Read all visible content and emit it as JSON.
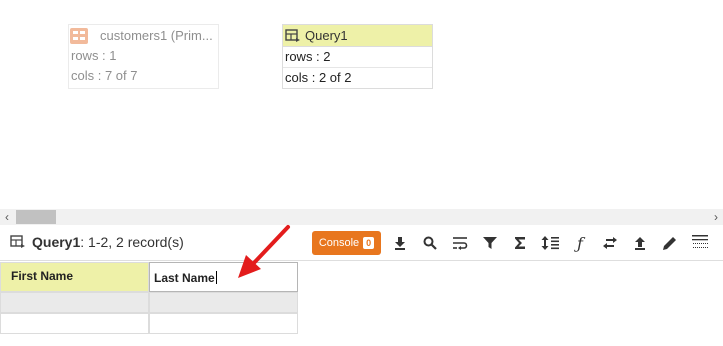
{
  "canvas": {
    "tables": [
      {
        "title": "customers1 (Prim...",
        "rows_text": "rows : 1",
        "cols_text": "cols : 7 of 7"
      }
    ],
    "query_node": {
      "title": "Query1",
      "rows_text": "rows : 2",
      "cols_text": "cols : 2 of 2"
    }
  },
  "result_bar": {
    "title": "Query1",
    "range_text": ": 1-2, 2 record(s)",
    "console_label": "Console",
    "console_count": "0",
    "tools": [
      "download-icon",
      "search-icon",
      "wrap-icon",
      "filter-icon",
      "sum-icon",
      "sort-icon",
      "function-icon",
      "swap-icon",
      "upload-icon",
      "edit-icon",
      "columns-icon"
    ]
  },
  "grid": {
    "columns": [
      "First Name",
      "Last Name"
    ],
    "rows": [
      [
        "",
        ""
      ],
      [
        "",
        ""
      ]
    ]
  }
}
